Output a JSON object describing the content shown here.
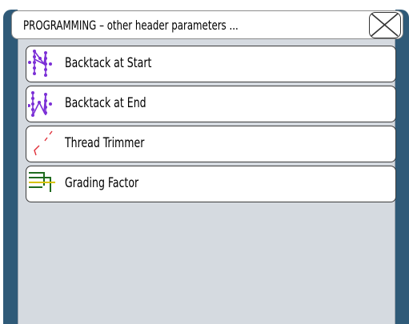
{
  "window": {
    "title": "PROGRAMMING – other header parameters ...",
    "close_icon": "close-x-icon"
  },
  "menu": {
    "items": [
      {
        "label": "Backtack at Start",
        "icon": "backtack-start-icon"
      },
      {
        "label": "Backtack at End",
        "icon": "backtack-end-icon"
      },
      {
        "label": "Thread Trimmer",
        "icon": "thread-trimmer-icon"
      },
      {
        "label": "Grading Factor",
        "icon": "grading-factor-icon"
      }
    ]
  },
  "colors": {
    "frame": "#2f5a78",
    "panel": "#d5dae0",
    "stitch": "#7b2fd6",
    "trim_red": "#e0303a",
    "grading_green": "#1f6b1f",
    "grading_yellow": "#d8c400"
  }
}
